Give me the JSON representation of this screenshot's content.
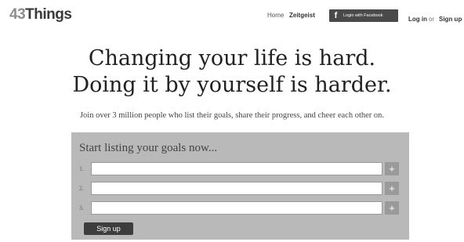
{
  "header": {
    "logo_number": "43",
    "logo_word": "Things",
    "nav": {
      "home": "Home",
      "zeitgeist": "Zeitgeist"
    },
    "facebook_button_label": "Login with Facebook",
    "facebook_icon_glyph": "f",
    "login": "Log in",
    "or": "or",
    "signup": "Sign up"
  },
  "hero": {
    "line1": "Changing your life is hard.",
    "line2": "Doing it by yourself is harder.",
    "subtitle": "Join over 3 million people who list their goals, share their progress, and cheer each other on."
  },
  "goals_panel": {
    "title": "Start listing your goals now...",
    "rows": [
      {
        "number": "1.",
        "value": "",
        "add_glyph": "+"
      },
      {
        "number": "2.",
        "value": "",
        "add_glyph": "+"
      },
      {
        "number": "3.",
        "value": "",
        "add_glyph": "+"
      }
    ],
    "signup_button": "Sign up"
  }
}
